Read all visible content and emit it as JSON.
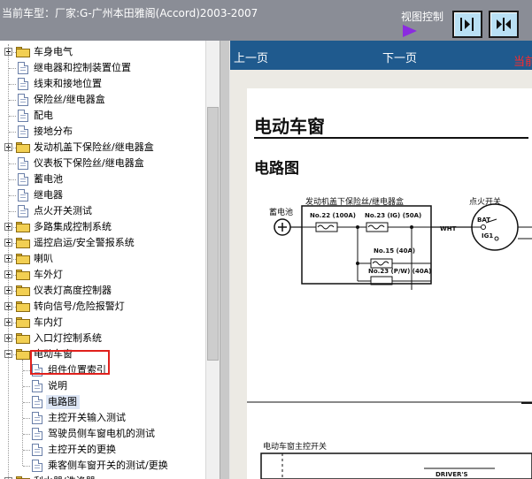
{
  "header": {
    "title": "当前车型：厂家:G-广州本田雅阁(Accord)2003-2007",
    "view_control_label": "视图控制",
    "buttons": [
      {
        "name": "expand-panel"
      },
      {
        "name": "split-panels"
      }
    ]
  },
  "tree": {
    "items": [
      {
        "label": "车身电气",
        "type": "folder",
        "expander": "plus",
        "level": 0
      },
      {
        "label": "继电器和控制装置位置",
        "type": "doc",
        "level": 0
      },
      {
        "label": "线束和接地位置",
        "type": "doc",
        "level": 0
      },
      {
        "label": "保险丝/继电器盒",
        "type": "doc",
        "level": 0
      },
      {
        "label": "配电",
        "type": "doc",
        "level": 0
      },
      {
        "label": "接地分布",
        "type": "doc",
        "level": 0
      },
      {
        "label": "发动机盖下保险丝/继电器盒",
        "type": "folder",
        "expander": "plus",
        "level": 0
      },
      {
        "label": "仪表板下保险丝/继电器盒",
        "type": "doc",
        "level": 0
      },
      {
        "label": "蓄电池",
        "type": "doc",
        "level": 0
      },
      {
        "label": "继电器",
        "type": "doc",
        "level": 0
      },
      {
        "label": "点火开关测试",
        "type": "doc",
        "level": 0
      },
      {
        "label": "多路集成控制系统",
        "type": "folder",
        "expander": "plus",
        "level": 0
      },
      {
        "label": "遥控启运/安全警报系统",
        "type": "folder",
        "expander": "plus",
        "level": 0
      },
      {
        "label": "喇叭",
        "type": "folder",
        "expander": "plus",
        "level": 0
      },
      {
        "label": "车外灯",
        "type": "folder",
        "expander": "plus",
        "level": 0
      },
      {
        "label": "仪表灯高度控制器",
        "type": "folder",
        "expander": "plus",
        "level": 0
      },
      {
        "label": "转向信号/危险报警灯",
        "type": "folder",
        "expander": "plus",
        "level": 0
      },
      {
        "label": "车内灯",
        "type": "folder",
        "expander": "plus",
        "level": 0
      },
      {
        "label": "入口灯控制系统",
        "type": "folder",
        "expander": "plus",
        "level": 0
      },
      {
        "label": "电动车窗",
        "type": "folder",
        "expander": "minus",
        "level": 0
      },
      {
        "label": "组件位置索引",
        "type": "doc",
        "level": 1
      },
      {
        "label": "说明",
        "type": "doc",
        "level": 1
      },
      {
        "label": "电路图",
        "type": "doc",
        "level": 1,
        "selected": true
      },
      {
        "label": "主控开关输入测试",
        "type": "doc",
        "level": 1
      },
      {
        "label": "驾驶员侧车窗电机的测试",
        "type": "doc",
        "level": 1
      },
      {
        "label": "主控开关的更换",
        "type": "doc",
        "level": 1
      },
      {
        "label": "乘客侧车窗开关的测试/更换",
        "type": "doc",
        "level": 1
      },
      {
        "label": "刮水器/洗涤器",
        "type": "folder",
        "expander": "plus",
        "level": 0
      }
    ]
  },
  "nav": {
    "prev_label": "上一页",
    "next_label": "下一页",
    "current_label": "当前"
  },
  "document": {
    "heading": "电动车窗",
    "subheading": "电路图",
    "schematic": {
      "battery_label": "蓄电池",
      "fuse_box_label": "发动机盖下保险丝/继电器盒",
      "ignition_label": "点火开关",
      "fuses": [
        "No.22 (100A)",
        "No.23 (IG) (50A)",
        "No.15 (40A)",
        "No.23 (P/W) (40A)"
      ],
      "wire_color": "WHT",
      "terminals": [
        "BAT",
        "IG1"
      ],
      "master_switch_label": "电动车窗主控开关",
      "drivers_label": "DRIVER'S"
    }
  }
}
